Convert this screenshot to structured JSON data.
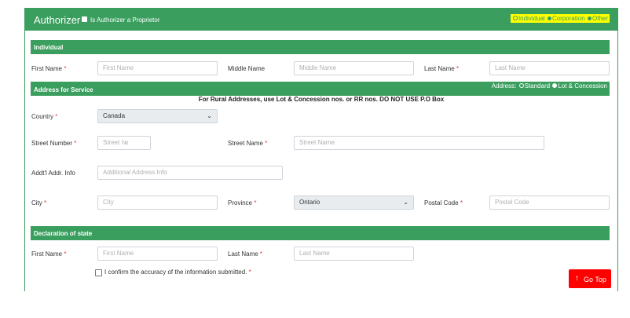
{
  "header": {
    "title": "Authorizer",
    "proprietor_label": "Is Authorizer a Proprietor",
    "type_options": [
      "Individual",
      "Corporation",
      "Other"
    ],
    "type_selected": "Individual"
  },
  "individual": {
    "section_title": "Individual",
    "first_name": {
      "label": "First Name",
      "required": "*",
      "placeholder": "First Name"
    },
    "middle_name": {
      "label": "Middle Name",
      "placeholder": "Middle Name"
    },
    "last_name": {
      "label": "Last Name",
      "required": "*",
      "placeholder": "Last Name"
    }
  },
  "address": {
    "section_title": "Address for Service",
    "options_label": "Address:",
    "options": [
      "Standard",
      "Lot & Concession"
    ],
    "option_selected": "Lot & Concession",
    "rural_note": "For Rural Addresses, use Lot & Concession nos. or RR nos. DO NOT USE P.O Box",
    "country": {
      "label": "Country",
      "required": "*",
      "value": "Canada"
    },
    "street_number": {
      "label": "Street Number",
      "required": "*",
      "placeholder": "Street №"
    },
    "street_name": {
      "label": "Street Name",
      "required": "*",
      "placeholder": "Street Name"
    },
    "addl_info": {
      "label": "Addt'l Addr. Info",
      "placeholder": "Additional Address Info"
    },
    "city": {
      "label": "City",
      "required": "*",
      "placeholder": "City"
    },
    "province": {
      "label": "Province",
      "required": "*",
      "value": "Ontario"
    },
    "postal_code": {
      "label": "Postal Code",
      "required": "*",
      "placeholder": "Postal Code"
    }
  },
  "declaration": {
    "section_title": "Declaration of state",
    "first_name": {
      "label": "First Name",
      "required": "*",
      "placeholder": "First Name"
    },
    "last_name": {
      "label": "Last Name",
      "required": "*",
      "placeholder": "Last Name"
    },
    "confirm_label": "I confirm the accuracy of the information submitted.",
    "confirm_required": "*"
  },
  "go_top": {
    "label": "Go Top",
    "icon": "arrow-up-icon"
  },
  "colors": {
    "primary": "#3a9e5e",
    "highlight": "#ffff00",
    "required": "#e53935",
    "go_top": "#ff0000"
  }
}
